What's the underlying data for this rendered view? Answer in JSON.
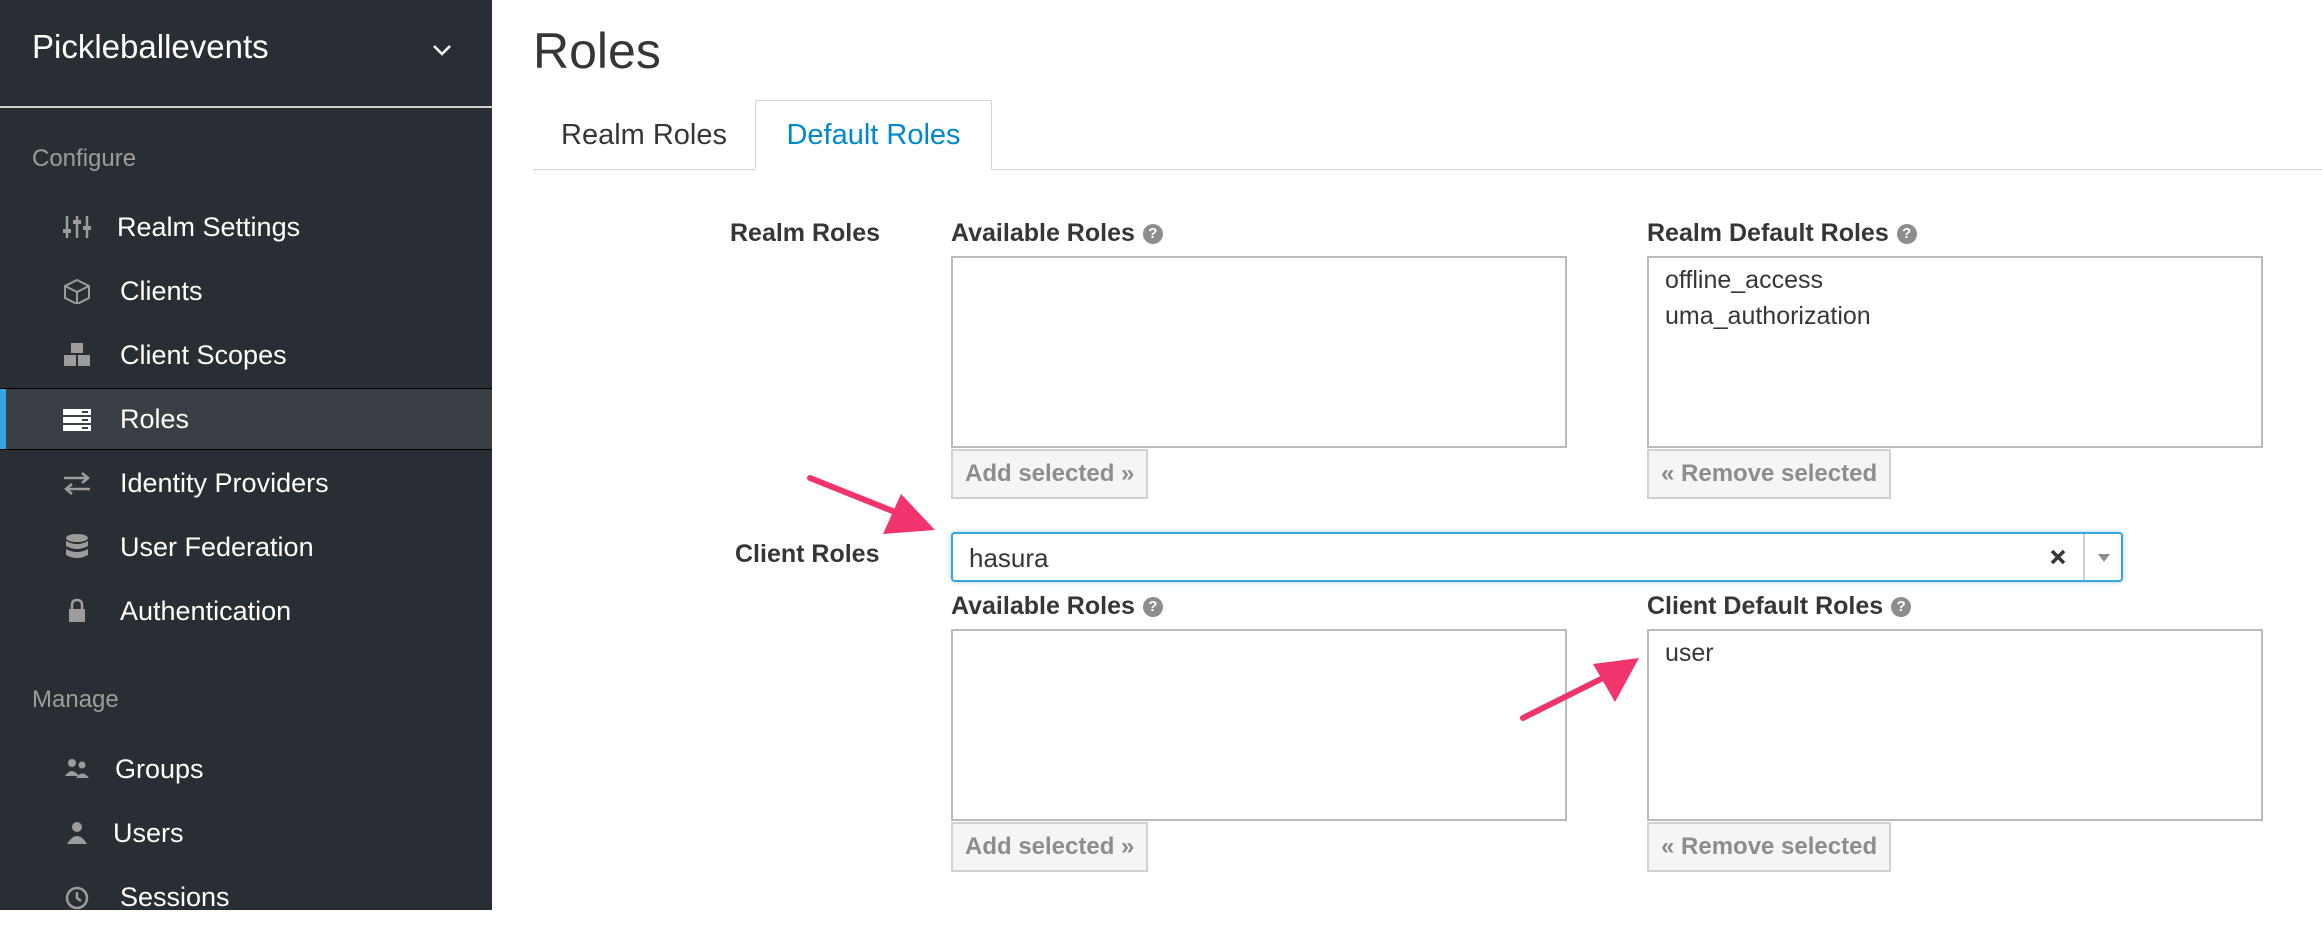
{
  "sidebar": {
    "realm_name": "Pickleballevents",
    "configure_label": "Configure",
    "manage_label": "Manage",
    "configure_items": [
      {
        "label": "Realm Settings",
        "icon": "sliders-icon"
      },
      {
        "label": "Clients",
        "icon": "cube-icon"
      },
      {
        "label": "Client Scopes",
        "icon": "cubes-icon"
      },
      {
        "label": "Roles",
        "icon": "roles-list-icon",
        "active": true
      },
      {
        "label": "Identity Providers",
        "icon": "exchange-icon"
      },
      {
        "label": "User Federation",
        "icon": "database-icon"
      },
      {
        "label": "Authentication",
        "icon": "lock-icon"
      }
    ],
    "manage_items": [
      {
        "label": "Groups",
        "icon": "users-group-icon"
      },
      {
        "label": "Users",
        "icon": "user-icon"
      },
      {
        "label": "Sessions",
        "icon": "clock-icon"
      }
    ]
  },
  "main": {
    "title": "Roles",
    "tabs": [
      {
        "label": "Realm Roles",
        "active": false
      },
      {
        "label": "Default Roles",
        "active": true
      }
    ],
    "realm_roles": {
      "row_label": "Realm Roles",
      "available_label": "Available Roles",
      "default_label": "Realm Default Roles",
      "available_options": [],
      "default_options": [
        "offline_access",
        "uma_authorization"
      ],
      "add_button": "Add selected »",
      "remove_button": "« Remove selected"
    },
    "client_roles": {
      "row_label": "Client Roles",
      "selected_client": "hasura",
      "available_label": "Available Roles",
      "default_label": "Client Default Roles",
      "available_options": [],
      "default_options": [
        "user"
      ],
      "add_button": "Add selected »",
      "remove_button": "« Remove selected"
    }
  },
  "colors": {
    "sidebar_bg": "#292e34",
    "active_accent": "#39a5dc",
    "tab_active_text": "#0088ce",
    "annotation_arrow": "#f0356e"
  }
}
